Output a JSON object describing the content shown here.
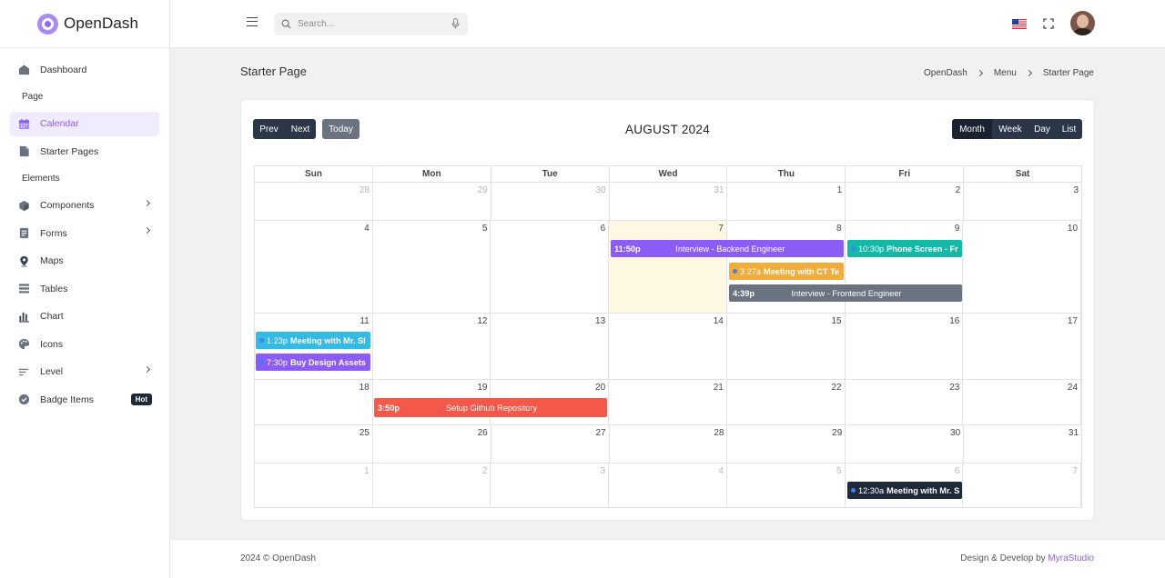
{
  "brand": {
    "name": "OpenDash"
  },
  "search": {
    "placeholder": "Search..."
  },
  "sidebar": {
    "items": [
      {
        "label": "Dashboard"
      },
      {
        "label": "Page"
      },
      {
        "label": "Calendar"
      },
      {
        "label": "Starter Pages"
      },
      {
        "label": "Elements"
      },
      {
        "label": "Components"
      },
      {
        "label": "Forms"
      },
      {
        "label": "Maps"
      },
      {
        "label": "Tables"
      },
      {
        "label": "Chart"
      },
      {
        "label": "Icons"
      },
      {
        "label": "Level"
      },
      {
        "label": "Badge Items",
        "badge": "Hot"
      }
    ]
  },
  "page": {
    "title": "Starter Page",
    "breadcrumb": [
      "OpenDash",
      "Menu",
      "Starter Page"
    ]
  },
  "calendar": {
    "prev_label": "Prev",
    "next_label": "Next",
    "today_label": "Today",
    "title": "AUGUST 2024",
    "views": [
      "Month",
      "Week",
      "Day",
      "List"
    ],
    "active_view": "Month",
    "days_of_week": [
      "Sun",
      "Mon",
      "Tue",
      "Wed",
      "Thu",
      "Fri",
      "Sat"
    ],
    "weeks": [
      [
        "28",
        "29",
        "30",
        "31",
        "1",
        "2",
        "3"
      ],
      [
        "4",
        "5",
        "6",
        "7",
        "8",
        "9",
        "10"
      ],
      [
        "11",
        "12",
        "13",
        "14",
        "15",
        "16",
        "17"
      ],
      [
        "18",
        "19",
        "20",
        "21",
        "22",
        "23",
        "24"
      ],
      [
        "25",
        "26",
        "27",
        "28",
        "29",
        "30",
        "31"
      ],
      [
        "1",
        "2",
        "3",
        "4",
        "5",
        "6",
        "7"
      ]
    ],
    "events": [
      {
        "time": "11:50p",
        "title": "Interview - Backend Engineer",
        "color": "#8b5cf6"
      },
      {
        "time": "10:30p",
        "title": "Phone Screen - Fr",
        "color": "#14b8a6"
      },
      {
        "time": "3:27a",
        "title": "Meeting with CT Te",
        "color": "#f0ad3b"
      },
      {
        "time": "4:39p",
        "title": "Interview - Frontend Engineer",
        "color": "#6b7280"
      },
      {
        "time": "1:23p",
        "title": "Meeting with Mr. Sl",
        "color": "#36b9e3"
      },
      {
        "time": "7:30p",
        "title": "Buy Design Assets",
        "color": "#8b5cf6"
      },
      {
        "time": "3:50p",
        "title": "Setup Github Repository",
        "color": "#f4584a"
      },
      {
        "time": "12:30a",
        "title": "Meeting with Mr. S",
        "color": "#1f2937"
      }
    ]
  },
  "footer": {
    "copyright": "2024 © OpenDash",
    "credit_prefix": "Design & Develop by",
    "credit_link": "MyraStudio"
  }
}
